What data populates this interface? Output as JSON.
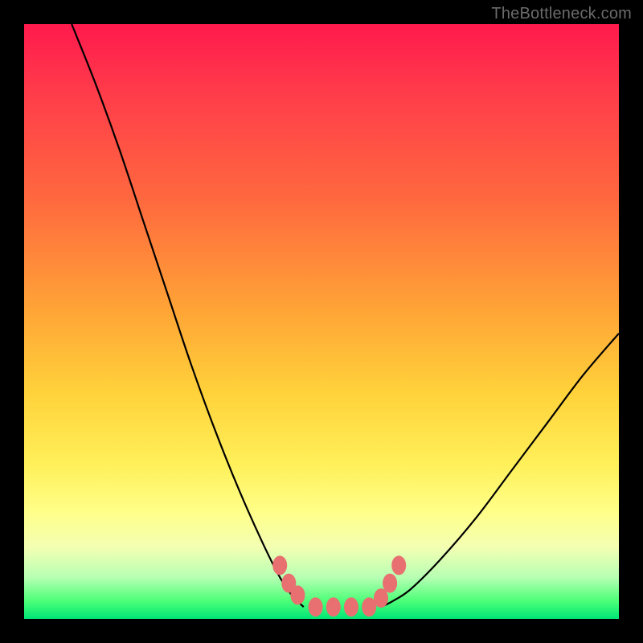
{
  "watermark": "TheBottleneck.com",
  "chart_data": {
    "type": "line",
    "title": "",
    "xlabel": "",
    "ylabel": "",
    "xlim": [
      0,
      100
    ],
    "ylim": [
      0,
      100
    ],
    "series": [
      {
        "name": "left-curve",
        "x": [
          8,
          12,
          16,
          20,
          24,
          28,
          32,
          36,
          40,
          43,
          45,
          47
        ],
        "values": [
          100,
          90,
          79,
          67,
          55,
          43,
          32,
          22,
          13,
          7,
          4,
          2
        ]
      },
      {
        "name": "right-curve",
        "x": [
          60,
          62,
          65,
          70,
          76,
          82,
          88,
          94,
          100
        ],
        "values": [
          2,
          3,
          5,
          10,
          17,
          25,
          33,
          41,
          48
        ]
      },
      {
        "name": "bottom-band",
        "x": [
          47,
          60
        ],
        "values": [
          2,
          2
        ]
      }
    ],
    "markers": {
      "name": "salmon-nodes",
      "points": [
        {
          "x": 43,
          "y": 9
        },
        {
          "x": 44.5,
          "y": 6
        },
        {
          "x": 46,
          "y": 4
        },
        {
          "x": 49,
          "y": 2
        },
        {
          "x": 52,
          "y": 2
        },
        {
          "x": 55,
          "y": 2
        },
        {
          "x": 58,
          "y": 2
        },
        {
          "x": 60,
          "y": 3.5
        },
        {
          "x": 61.5,
          "y": 6
        },
        {
          "x": 63,
          "y": 9
        }
      ]
    },
    "gradient_stops": [
      {
        "pos": 0,
        "color": "#ff1a4d"
      },
      {
        "pos": 30,
        "color": "#ff6a3e"
      },
      {
        "pos": 62,
        "color": "#ffd23a"
      },
      {
        "pos": 88,
        "color": "#f3ffb3"
      },
      {
        "pos": 100,
        "color": "#00e676"
      }
    ],
    "marker_color": "#e87070",
    "curve_color": "#000000"
  }
}
